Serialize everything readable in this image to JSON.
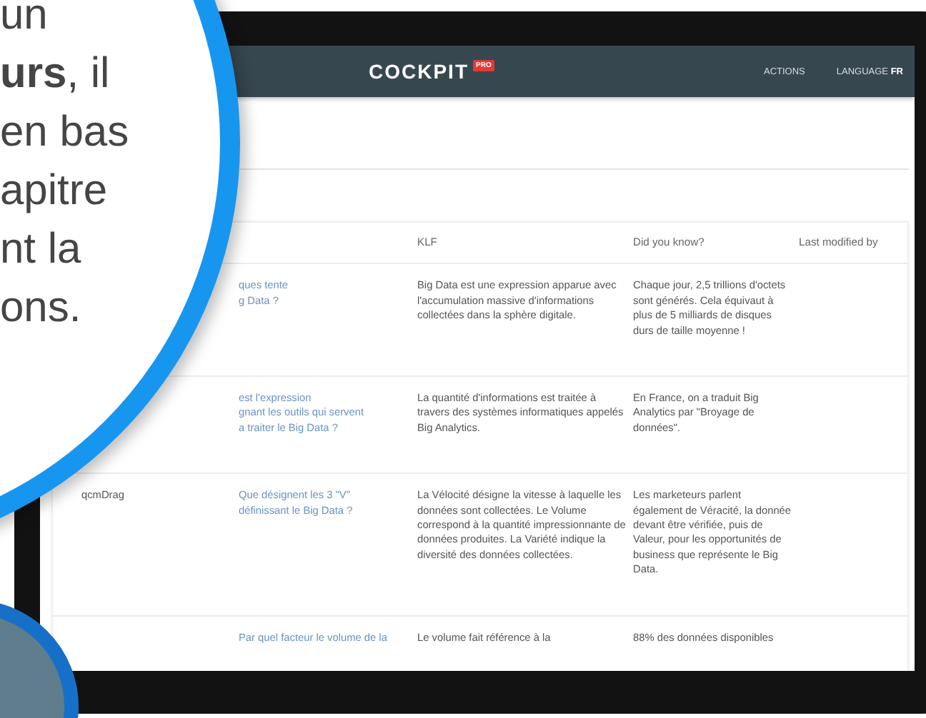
{
  "callout": {
    "lines": [
      "un",
      "**urs**, il",
      "en bas",
      "apitre",
      "nt la",
      "ons."
    ]
  },
  "header": {
    "logo": "COCKPIT",
    "logo_badge": "PRO",
    "actions": "ACTIONS",
    "language_label": "LANGUAGE",
    "language_value": "FR"
  },
  "table": {
    "columns": [
      "KLF",
      "Did you know?",
      "Last modified by"
    ],
    "rows": [
      {
        "question_lines": [
          "ques tente",
          "g Data ?"
        ],
        "klf": "Big Data est une expression apparue avec l'accumulation massive d'informations collectées dans la sphère digitale.",
        "did_you_know": "Chaque jour, 2,5 trillions d'octets sont générés. Cela équivaut à plus de 5 milliards de disques durs de taille moyenne !"
      },
      {
        "question_lines": [
          "est l'expression",
          "gnant les outils qui servent",
          "a traiter le Big Data ?"
        ],
        "klf": "La quantité d'informations est traitée à travers des systèmes informatiques appelés Big Analytics.",
        "did_you_know": "En France, on a traduit Big Analytics par \"Broyage de données\"."
      },
      {
        "type": "qcmDrag",
        "question_lines": [
          "Que désignent les 3 \"V\"",
          "définissant le Big Data ?"
        ],
        "klf": "La Vélocité désigne la vitesse à laquelle les données sont collectées. Le Volume correspond à la quantité impressionnante de données produites. La Variété indique la diversité des données collectées.",
        "did_you_know": "Les marketeurs parlent également de Véracité, la donnée devant être vérifiée, puis de Valeur, pour les opportunités de business que représente le Big Data."
      },
      {
        "question_lines": [
          "Par quel facteur le volume de la"
        ],
        "klf": "Le volume fait référence à la",
        "did_you_know": "88% des données disponibles"
      }
    ]
  }
}
